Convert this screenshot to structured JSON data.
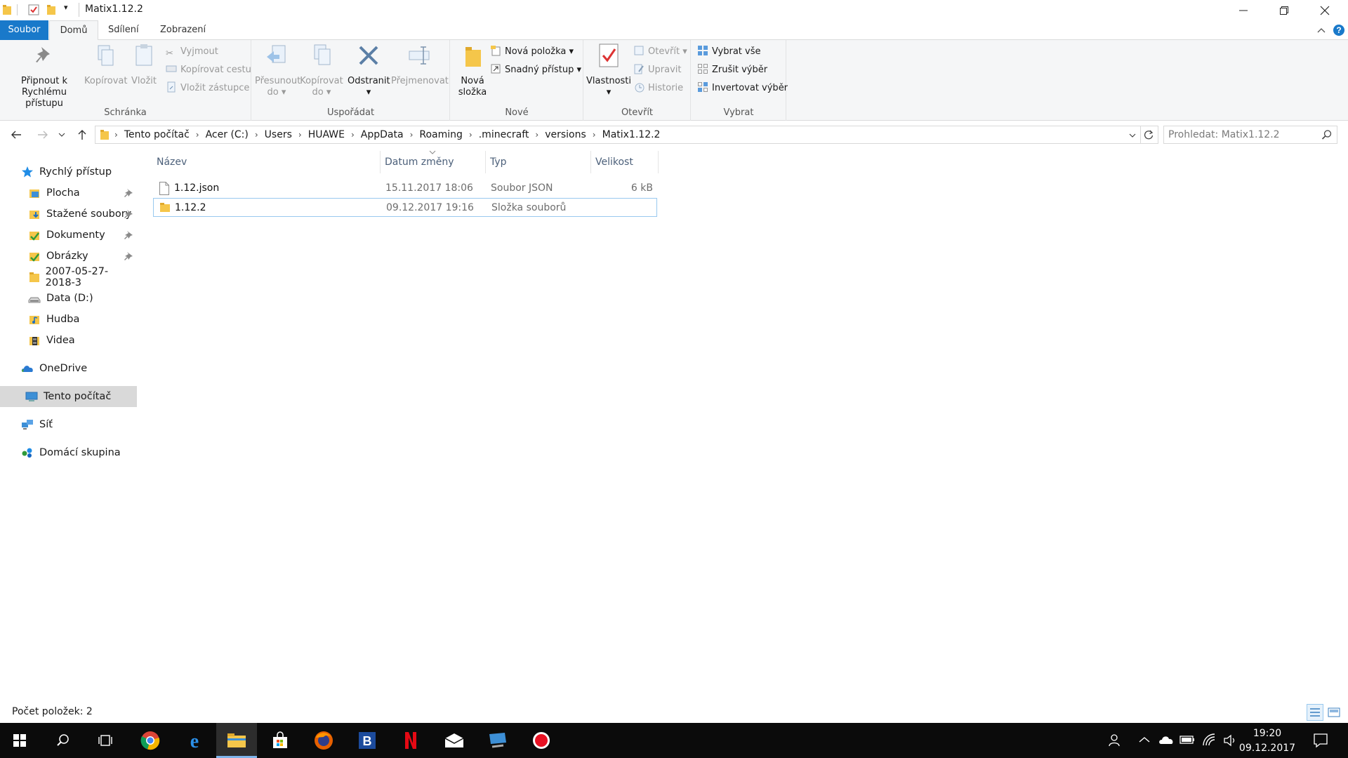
{
  "window": {
    "title": "Matix1.12.2"
  },
  "tabs": {
    "file": "Soubor",
    "home": "Domů",
    "share": "Sdílení",
    "view": "Zobrazení"
  },
  "ribbon": {
    "clipboard": {
      "label": "Schránka",
      "pin_line1": "Připnout k",
      "pin_line2": "Rychlému přístupu",
      "copy": "Kopírovat",
      "paste": "Vložit",
      "cut": "Vyjmout",
      "copy_path": "Kopírovat cestu",
      "paste_shortcut": "Vložit zástupce"
    },
    "organize": {
      "label": "Uspořádat",
      "move_line1": "Přesunout",
      "move_line2": "do",
      "copyto_line1": "Kopírovat",
      "copyto_line2": "do",
      "delete": "Odstranit",
      "rename": "Přejmenovat"
    },
    "new": {
      "label": "Nové",
      "new_folder_line1": "Nová",
      "new_folder_line2": "složka",
      "new_item": "Nová položka",
      "easy_access": "Snadný přístup"
    },
    "open": {
      "label": "Otevřít",
      "properties": "Vlastnosti",
      "open": "Otevřít",
      "edit": "Upravit",
      "history": "Historie"
    },
    "select": {
      "label": "Vybrat",
      "select_all": "Vybrat vše",
      "select_none": "Zrušit výběr",
      "invert": "Invertovat výběr"
    }
  },
  "address": {
    "crumbs": [
      "Tento počítač",
      "Acer (C:)",
      "Users",
      "HUAWE",
      "AppData",
      "Roaming",
      ".minecraft",
      "versions",
      "Matix1.12.2"
    ],
    "search_placeholder": "Prohledat: Matix1.12.2"
  },
  "nav": {
    "quick_access": "Rychlý přístup",
    "items": [
      "Plocha",
      "Stažené soubory",
      "Dokumenty",
      "Obrázky",
      "2007-05-27-2018-3",
      "Data (D:)",
      "Hudba",
      "Videa"
    ],
    "onedrive": "OneDrive",
    "this_pc": "Tento počítač",
    "network": "Síť",
    "homegroup": "Domácí skupina"
  },
  "columns": {
    "name": "Název",
    "date": "Datum změny",
    "type": "Typ",
    "size": "Velikost"
  },
  "files": [
    {
      "name": "1.12.json",
      "date": "15.11.2017 18:06",
      "type": "Soubor JSON",
      "size": "6 kB",
      "icon": "file-icon"
    },
    {
      "name": "1.12.2",
      "date": "09.12.2017 19:16",
      "type": "Složka souborů",
      "size": "",
      "icon": "folder-icon"
    }
  ],
  "status": {
    "count": "Počet položek: 2"
  },
  "clock": {
    "time": "19:20",
    "date": "09.12.2017"
  },
  "colors": {
    "accent": "#1979ca",
    "folder": "#f5c64a",
    "selection_border": "#99c9ef",
    "taskbar": "#0b0b0b"
  }
}
